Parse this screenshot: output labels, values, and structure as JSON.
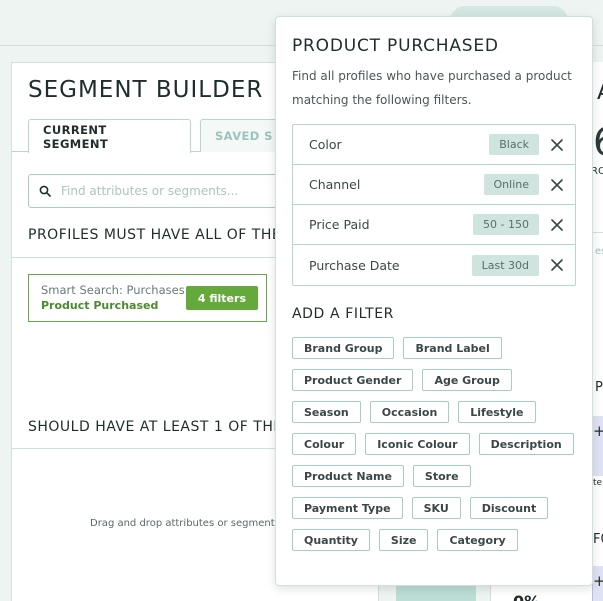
{
  "builder": {
    "title": "SEGMENT BUILDER",
    "tabs": [
      "CURRENT SEGMENT",
      "SAVED S"
    ],
    "search_placeholder": "Find attributes or segments...",
    "must_have_heading": "PROFILES MUST HAVE ALL OF THE",
    "should_have_heading": "SHOULD HAVE AT LEAST 1 OF THE",
    "smart_search": {
      "line1": "Smart Search: Purchases",
      "line2": "Product Purchased",
      "badge": "4 filters"
    },
    "drop_hint": "Drag and drop attributes or segments"
  },
  "right_peek": {
    "letter_a": "A",
    "digit": "6",
    "ro": "RO",
    "es": "es",
    "p": "P",
    "plus": "+",
    "te": "te",
    "fo": "F0",
    "pct": "0%"
  },
  "popover": {
    "title": "PRODUCT PURCHASED",
    "description": "Find all profiles who have purchased a product matching the following filters.",
    "filters": [
      {
        "name": "Color",
        "value": "Black"
      },
      {
        "name": "Channel",
        "value": "Online"
      },
      {
        "name": "Price Paid",
        "value": "50 - 150"
      },
      {
        "name": "Purchase Date",
        "value": "Last 30d"
      }
    ],
    "add_heading": "ADD A FILTER",
    "chips": [
      "Brand Group",
      "Brand Label",
      "Product Gender",
      "Age Group",
      "Season",
      "Occasion",
      "Lifestyle",
      "Colour",
      "Iconic Colour",
      "Description",
      "Product Name",
      "Store",
      "Payment Type",
      "SKU",
      "Discount",
      "Quantity",
      "Size",
      "Category"
    ]
  },
  "colors": {
    "accent_green": "#65a83c",
    "teal_border": "#b7d6cf",
    "value_pill": "#cfe4df"
  }
}
